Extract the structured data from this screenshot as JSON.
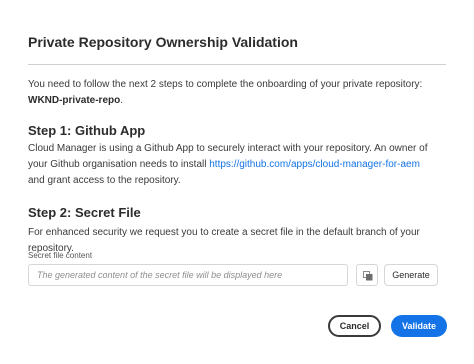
{
  "dialog": {
    "title": "Private Repository Ownership Validation",
    "intro_text": "You need to follow the next 2 steps to complete the onboarding of your private repository: ",
    "repo_name": "WKND-private-repo",
    "intro_end": "."
  },
  "step1": {
    "heading": "Step 1: Github App",
    "text_before_link": "Cloud Manager is using a Github App to securely interact with your repository. An owner of your Github organisation needs to install ",
    "link_text": "https://github.com/apps/cloud-manager-for-aem",
    "text_after_link": " and grant access to the repository."
  },
  "step2": {
    "heading": "Step 2: Secret File",
    "text": "For enhanced security we request you to create a secret file in the default branch of your repository.",
    "field_label": "Secret file content",
    "field_placeholder": "The generated content of the secret file will be displayed here",
    "field_value": "",
    "copy_icon": "copy-icon",
    "generate_label": "Generate"
  },
  "footer": {
    "cancel_label": "Cancel",
    "validate_label": "Validate"
  },
  "colors": {
    "accent": "#1473e6",
    "text": "#2c2c2c",
    "divider": "#cfcfcf"
  }
}
